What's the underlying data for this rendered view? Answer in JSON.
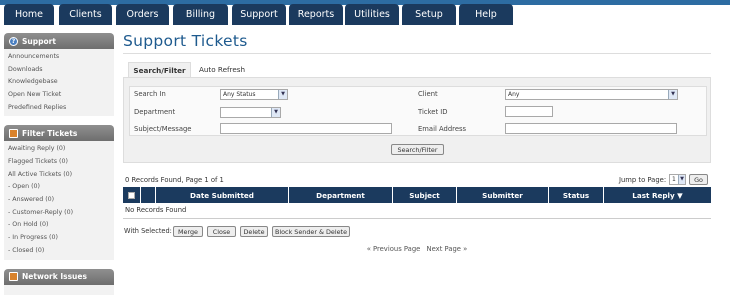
{
  "nav": {
    "tabs": [
      "Home",
      "Clients",
      "Orders",
      "Billing",
      "Support",
      "Reports",
      "Utilities",
      "Setup",
      "Help"
    ]
  },
  "sidebar": {
    "support": {
      "title": "Support",
      "items": [
        "Announcements",
        "Downloads",
        "Knowledgebase",
        "Open New Ticket",
        "Predefined Replies"
      ]
    },
    "filter": {
      "title": "Filter Tickets",
      "items": [
        "Awaiting Reply (0)",
        "Flagged Tickets (0)",
        "All Active Tickets (0)",
        "- Open (0)",
        "- Answered (0)",
        "- Customer-Reply (0)",
        "- On Hold (0)",
        "- In Progress (0)",
        "- Closed (0)"
      ]
    },
    "network": {
      "title": "Network Issues"
    }
  },
  "page": {
    "title": "Support Tickets"
  },
  "tabs": {
    "search_filter": "Search/Filter",
    "auto_refresh": "Auto Refresh"
  },
  "form": {
    "search_in_label": "Search In",
    "search_in_value": "Any Status",
    "department_label": "Department",
    "department_value": "",
    "subject_label": "Subject/Message",
    "subject_value": "",
    "client_label": "Client",
    "client_value": "Any",
    "ticket_id_label": "Ticket ID",
    "ticket_id_value": "",
    "email_label": "Email Address",
    "email_value": "",
    "submit_label": "Search/Filter"
  },
  "results": {
    "summary": "0 Records Found, Page 1 of 1",
    "jump_label": "Jump to Page:",
    "jump_value": "1",
    "go_label": "Go",
    "no_records": "No Records Found"
  },
  "grid": {
    "columns": [
      "Date Submitted",
      "Department",
      "Subject",
      "Submitter",
      "Status",
      "Last Reply ▼"
    ]
  },
  "actions": {
    "with_selected": "With Selected:",
    "merge": "Merge",
    "close": "Close",
    "delete": "Delete",
    "block_delete": "Block Sender & Delete"
  },
  "pager": {
    "previous": "« Previous Page",
    "next": "Next Page »"
  },
  "colors": {
    "nav_bg": "#1b3a5e",
    "title": "#1e5a8e",
    "grid_header": "#1b3a5e"
  }
}
